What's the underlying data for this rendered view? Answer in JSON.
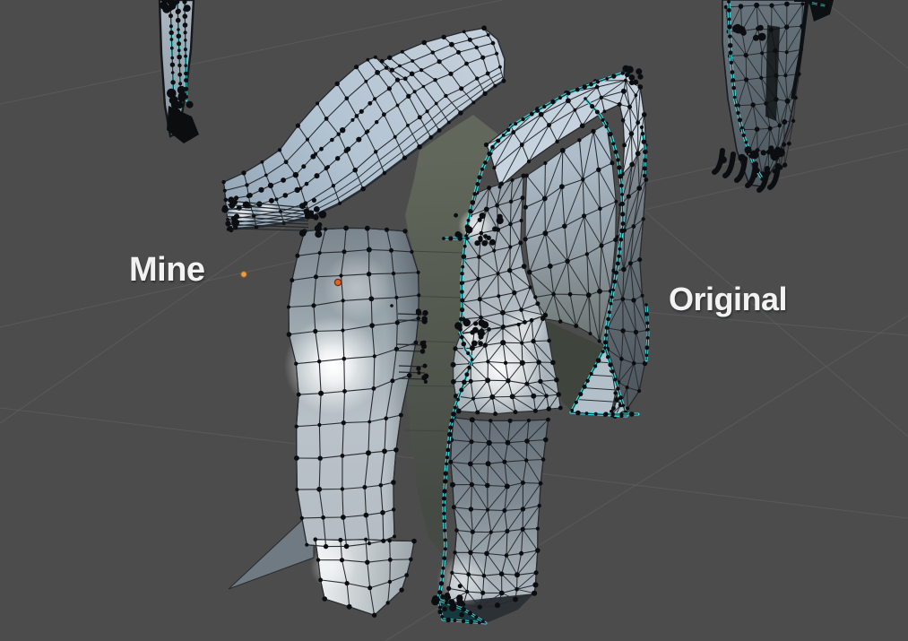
{
  "viewport": {
    "type": "3d-viewport",
    "mode": "edit-mode-wireframe",
    "background_color": "#4c4c4c",
    "grid_line_color": "#5e5e5e"
  },
  "labels": {
    "mine": "Mine",
    "original": "Original"
  },
  "objects": [
    {
      "id": "mesh-mine",
      "label": "Mine",
      "wireframe": "quad",
      "selected_edges": false
    },
    {
      "id": "mesh-original",
      "label": "Original",
      "wireframe": "triangulated",
      "selected_edges": true
    },
    {
      "id": "mesh-fragment-top-left",
      "selected_edges": true
    },
    {
      "id": "mesh-fragment-top-right",
      "selected_edges": true
    }
  ],
  "colors": {
    "surface_light": "#cdd7df",
    "surface_steel": "#b2c3d2",
    "surface_mid": "#98a3ab",
    "surface_dark": "#6a7279",
    "inner_shadow": "#565c50",
    "wire": "#282c30",
    "vertex": "#0b0d10",
    "selected_edge": "#3ce4e8",
    "cursor_orange": "#ec9e44",
    "origin_orange": "#de6428",
    "label_text": "#f2f2f2",
    "highlight": "#ffffff"
  }
}
